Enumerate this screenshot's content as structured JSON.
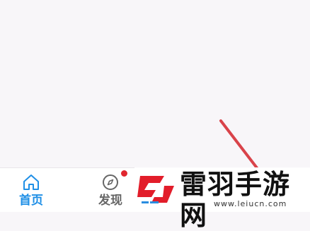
{
  "tabbar": {
    "home_label": "首页",
    "discover_label": "发现",
    "discover_has_badge": true
  },
  "watermark": {
    "title": "雷羽手游网",
    "url": "www.leiucn.com"
  },
  "colors": {
    "active_tab": "#1f8fe6",
    "inactive_tab": "#666666",
    "badge": "#e0262f",
    "arrow": "#d9434a"
  }
}
